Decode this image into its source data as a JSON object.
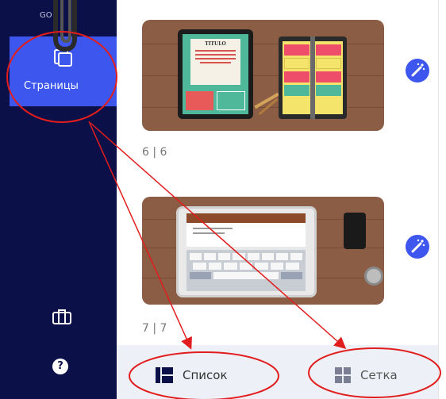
{
  "sidebar": {
    "top_stub": "GO",
    "active_item": {
      "label": "Страницы",
      "icon": "page-stack-icon"
    },
    "bottom_icons": [
      "briefcase-icon",
      "help-icon"
    ],
    "help_glyph": "?"
  },
  "pages": [
    {
      "number_label": "6 | 6",
      "thumbnail": "tablet-and-planner",
      "tablet_title": "TITULO"
    },
    {
      "number_label": "7 | 7",
      "thumbnail": "ipad-keyboard-and-phone"
    }
  ],
  "view_toggle": {
    "list_label": "Список",
    "grid_label": "Сетка",
    "active": "list"
  },
  "colors": {
    "sidebar_bg": "#0c1048",
    "accent": "#3d57ee",
    "annotation": "#e11d1d",
    "wood": "#8b5d45"
  }
}
